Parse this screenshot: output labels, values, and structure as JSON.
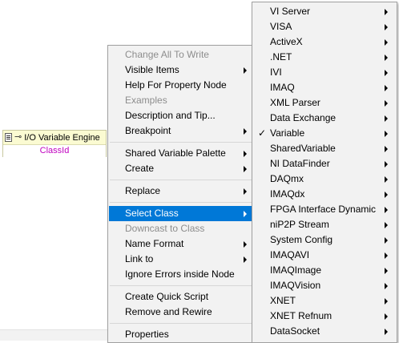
{
  "property_node": {
    "title": "I/O Variable Engine",
    "property": "ClassId",
    "wire_glyph": "⊸"
  },
  "context_menu": {
    "items": [
      {
        "label": "Change All To Write",
        "disabled": true,
        "submenu": false
      },
      {
        "label": "Visible Items",
        "disabled": false,
        "submenu": true
      },
      {
        "label": "Help For Property Node",
        "disabled": false,
        "submenu": false
      },
      {
        "label": "Examples",
        "disabled": true,
        "submenu": false
      },
      {
        "label": "Description and Tip...",
        "disabled": false,
        "submenu": false
      },
      {
        "label": "Breakpoint",
        "disabled": false,
        "submenu": true
      },
      {
        "label": "Shared Variable Palette",
        "disabled": false,
        "submenu": true
      },
      {
        "label": "Create",
        "disabled": false,
        "submenu": true
      },
      {
        "label": "Replace",
        "disabled": false,
        "submenu": true
      },
      {
        "label": "Select Class",
        "disabled": false,
        "submenu": true,
        "selected": true
      },
      {
        "label": "Downcast to Class",
        "disabled": true,
        "submenu": false
      },
      {
        "label": "Name Format",
        "disabled": false,
        "submenu": true
      },
      {
        "label": "Link to",
        "disabled": false,
        "submenu": true
      },
      {
        "label": "Ignore Errors inside Node",
        "disabled": false,
        "submenu": false
      },
      {
        "label": "Create Quick Script",
        "disabled": false,
        "submenu": false
      },
      {
        "label": "Remove and Rewire",
        "disabled": false,
        "submenu": false
      },
      {
        "label": "Properties",
        "disabled": false,
        "submenu": false
      }
    ]
  },
  "class_submenu": {
    "items": [
      {
        "label": "VI Server",
        "checked": false
      },
      {
        "label": "VISA",
        "checked": false
      },
      {
        "label": "ActiveX",
        "checked": false
      },
      {
        "label": ".NET",
        "checked": false
      },
      {
        "label": "IVI",
        "checked": false
      },
      {
        "label": "IMAQ",
        "checked": false
      },
      {
        "label": "XML Parser",
        "checked": false
      },
      {
        "label": "Data Exchange",
        "checked": false
      },
      {
        "label": "Variable",
        "checked": true
      },
      {
        "label": "SharedVariable",
        "checked": false
      },
      {
        "label": "NI DataFinder",
        "checked": false
      },
      {
        "label": "DAQmx",
        "checked": false
      },
      {
        "label": "IMAQdx",
        "checked": false
      },
      {
        "label": "FPGA Interface Dynamic",
        "checked": false
      },
      {
        "label": "niP2P Stream",
        "checked": false
      },
      {
        "label": "System Config",
        "checked": false
      },
      {
        "label": "IMAQAVI",
        "checked": false
      },
      {
        "label": "IMAQImage",
        "checked": false
      },
      {
        "label": "IMAQVision",
        "checked": false
      },
      {
        "label": "XNET",
        "checked": false
      },
      {
        "label": "XNET Refnum",
        "checked": false
      },
      {
        "label": "DataSocket",
        "checked": false
      }
    ],
    "check_glyph": "✓"
  },
  "colors": {
    "menu_bg": "#f2f2f2",
    "highlight": "#0078d7",
    "disabled_text": "#8d8d8d",
    "property_text": "#c000c0",
    "node_header": "#fbfbd2"
  }
}
